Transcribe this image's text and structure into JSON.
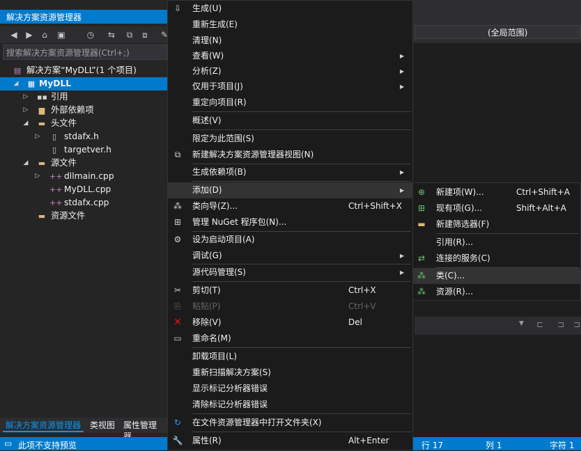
{
  "solution_explorer": {
    "title": "解决方案资源管理器",
    "search_placeholder": "搜索解决方案资源管理器(Ctrl+;)",
    "tree": [
      {
        "label": "解决方案“MyDLL”(1 个项目)",
        "icon": "solution-icon"
      },
      {
        "label": "MyDLL",
        "icon": "project-icon",
        "selected": true
      },
      {
        "label": "引用",
        "icon": "references-icon"
      },
      {
        "label": "外部依赖项",
        "icon": "external-deps-icon"
      },
      {
        "label": "头文件",
        "icon": "folder-icon"
      },
      {
        "label": "stdafx.h",
        "icon": "header-file-icon"
      },
      {
        "label": "targetver.h",
        "icon": "header-file-icon"
      },
      {
        "label": "源文件",
        "icon": "folder-icon"
      },
      {
        "label": "dllmain.cpp",
        "icon": "cpp-file-icon"
      },
      {
        "label": "MyDLL.cpp",
        "icon": "cpp-file-icon"
      },
      {
        "label": "stdafx.cpp",
        "icon": "cpp-file-icon"
      },
      {
        "label": "资源文件",
        "icon": "folder-icon"
      }
    ],
    "tabs": [
      "解决方案资源管理器",
      "类视图",
      "属性管理器"
    ]
  },
  "editor": {
    "scope": "(全局范围)"
  },
  "status": {
    "message": "此项不支持预览",
    "line": "行 17",
    "col": "列 1",
    "char": "字符 1"
  },
  "context_menu": [
    {
      "label": "生成(U)",
      "icon": "build-icon"
    },
    {
      "label": "重新生成(E)"
    },
    {
      "label": "清理(N)"
    },
    {
      "label": "查看(W)",
      "submenu": true
    },
    {
      "label": "分析(Z)",
      "submenu": true
    },
    {
      "label": "仅用于项目(J)",
      "submenu": true
    },
    {
      "label": "重定向项目(R)"
    },
    {
      "label": "概述(V)"
    },
    {
      "label": "限定为此范围(S)"
    },
    {
      "label": "新建解决方案资源管理器视图(N)",
      "icon": "new-view-icon"
    },
    {
      "label": "生成依赖项(B)",
      "submenu": true
    },
    {
      "label": "添加(D)",
      "submenu": true
    },
    {
      "label": "类向导(Z)...",
      "shortcut": "Ctrl+Shift+X",
      "icon": "class-wizard-icon"
    },
    {
      "label": "管理 NuGet 程序包(N)...",
      "icon": "nuget-icon"
    },
    {
      "label": "设为启动项目(A)",
      "icon": "gear-icon"
    },
    {
      "label": "调试(G)",
      "submenu": true
    },
    {
      "label": "源代码管理(S)",
      "submenu": true
    },
    {
      "label": "剪切(T)",
      "shortcut": "Ctrl+X",
      "icon": "scissors-icon"
    },
    {
      "label": "粘贴(P)",
      "shortcut": "Ctrl+V",
      "icon": "paste-icon",
      "disabled": true
    },
    {
      "label": "移除(V)",
      "shortcut": "Del",
      "icon": "remove-icon"
    },
    {
      "label": "重命名(M)",
      "icon": "rename-icon"
    },
    {
      "label": "卸载项目(L)"
    },
    {
      "label": "重新扫描解决方案(S)"
    },
    {
      "label": "显示标记分析器错误"
    },
    {
      "label": "清除标记分析器错误"
    },
    {
      "label": "在文件资源管理器中打开文件夹(X)",
      "icon": "refresh-icon"
    },
    {
      "label": "属性(R)",
      "shortcut": "Alt+Enter",
      "icon": "wrench-icon"
    }
  ],
  "add_submenu": [
    {
      "label": "新建项(W)...",
      "shortcut": "Ctrl+Shift+A",
      "icon": "new-item-icon"
    },
    {
      "label": "现有项(G)...",
      "shortcut": "Shift+Alt+A",
      "icon": "existing-item-icon"
    },
    {
      "label": "新建筛选器(F)",
      "icon": "new-filter-icon"
    },
    {
      "label": "引用(R)..."
    },
    {
      "label": "连接的服务(C)",
      "icon": "connected-service-icon"
    },
    {
      "label": "类(C)...",
      "icon": "class-icon",
      "highlighted": true
    },
    {
      "label": "资源(R)...",
      "icon": "resource-icon"
    }
  ]
}
